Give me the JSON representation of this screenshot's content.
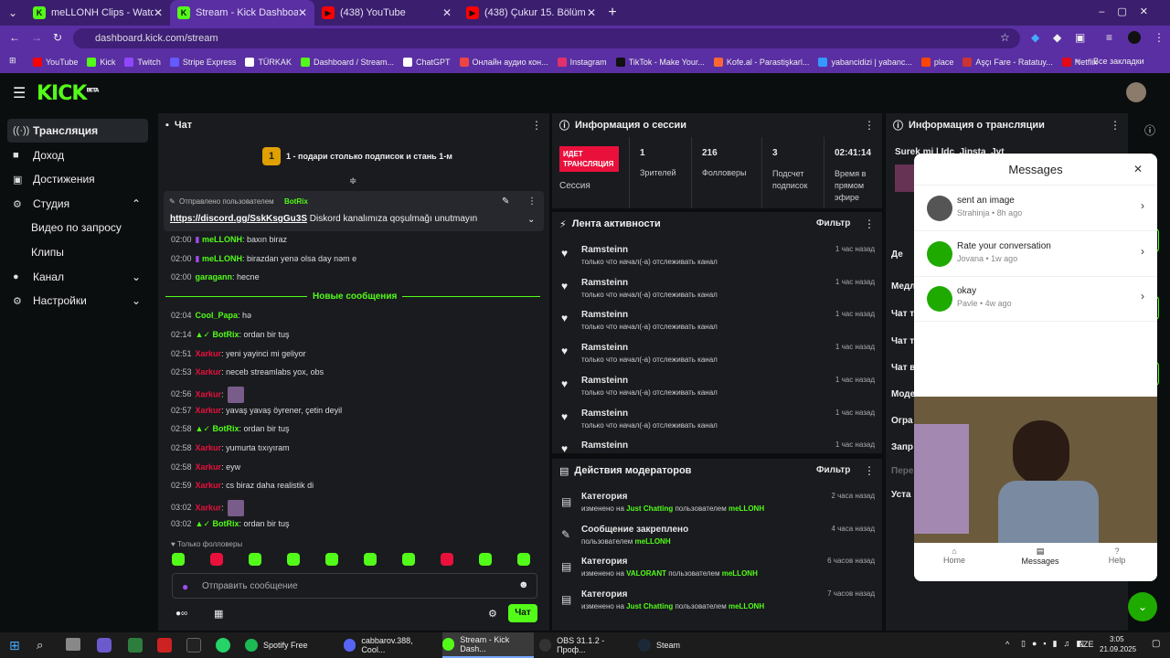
{
  "browser": {
    "tabs": [
      {
        "title": "meLLONH Clips - Watch Live or…",
        "fav": "K",
        "color": "#53fc18",
        "active": false
      },
      {
        "title": "Stream - Kick Dashboard",
        "fav": "K",
        "color": "#53fc18",
        "active": true
      },
      {
        "title": "(438) YouTube",
        "fav": "▶",
        "color": "#ff0000",
        "active": false
      },
      {
        "title": "(438) Çukur 15. Bölüm - YouTube",
        "fav": "▶",
        "color": "#ff0000",
        "active": false
      }
    ],
    "url": "dashboard.kick.com/stream",
    "bookmarks": [
      {
        "label": "YouTube",
        "color": "#ff0000"
      },
      {
        "label": "Kick",
        "color": "#53fc18"
      },
      {
        "label": "Twitch",
        "color": "#9146ff"
      },
      {
        "label": "Stripe Express",
        "color": "#635bff"
      },
      {
        "label": "TÜRKAK",
        "color": "#ffffff"
      },
      {
        "label": "Dashboard / Stream...",
        "color": "#53fc18"
      },
      {
        "label": "ChatGPT",
        "color": "#ffffff"
      },
      {
        "label": "Онлайн аудио кон...",
        "color": "#e44"
      },
      {
        "label": "Instagram",
        "color": "#e1306c"
      },
      {
        "label": "TikTok - Make Your...",
        "color": "#111111"
      },
      {
        "label": "Kofe.al - Parastişkarl...",
        "color": "#ff6633"
      },
      {
        "label": "yabancidizi | yabanc...",
        "color": "#3399ff"
      },
      {
        "label": "place",
        "color": "#ff4400"
      },
      {
        "label": "Aşçı Fare - Ratatuy...",
        "color": "#cc3333"
      },
      {
        "label": "Netflix",
        "color": "#e50914"
      }
    ],
    "all_bookmarks": "Все закладки"
  },
  "logo": "KICK",
  "logo_sup": "BETA",
  "sidebar": [
    {
      "label": "Трансляция",
      "icon": "broadcast-icon",
      "glyph": "((·))",
      "active": true
    },
    {
      "label": "Доход",
      "icon": "wallet-icon",
      "glyph": "■",
      "active": false
    },
    {
      "label": "Достижения",
      "icon": "trophy-icon",
      "glyph": "▣",
      "active": false
    },
    {
      "label": "Студия",
      "icon": "studio-icon",
      "glyph": "⚙",
      "active": false
    },
    {
      "label": "Видео по запросу",
      "icon": "",
      "glyph": "",
      "active": false
    },
    {
      "label": "Клипы",
      "icon": "",
      "glyph": "",
      "active": false
    },
    {
      "label": "Канал",
      "icon": "user-icon",
      "glyph": "●",
      "active": false
    },
    {
      "label": "Настройки",
      "icon": "gear-icon",
      "glyph": "⚙",
      "active": false
    }
  ],
  "chat": {
    "title": "Чат",
    "goal_num": "1",
    "goal_text": "1 - подари столько подписок и стань 1-м",
    "pinned_by": "Отправлено пользователем",
    "pinned_user": "BotRix",
    "pinned_link": "https://discord.gg/SskKsgGu3S",
    "pinned_text": " Diskord kanalımıza qoşulmağı unutmayın",
    "new_messages": "Новые сообщения",
    "followers_only": "Только фолловеры",
    "input_placeholder": "Отправить сообщение",
    "send": "Чат",
    "lines_before": [
      {
        "time": "02:00",
        "user": "meLLONH",
        "color": "grn",
        "text": ": baxın biraz"
      },
      {
        "time": "02:00",
        "user": "meLLONH",
        "color": "grn",
        "text": ": birazdan yenə olsa day nəm e"
      },
      {
        "time": "02:00",
        "user": "garagann",
        "color": "grn",
        "text": ": hecne"
      }
    ],
    "lines_after": [
      {
        "time": "02:04",
        "user": "Cool_Papa",
        "color": "grn",
        "text": ": hə"
      },
      {
        "time": "02:14",
        "user": "BotRix",
        "color": "grn",
        "text": ": ordan bir tuş"
      },
      {
        "time": "02:51",
        "user": "Xarkur",
        "color": "red",
        "text": ": yeni yayinci mi geliyor"
      },
      {
        "time": "02:53",
        "user": "Xarkur",
        "color": "red",
        "text": ": neceb streamlabs yox, obs"
      },
      {
        "time": "02:56",
        "user": "Xarkur",
        "color": "red",
        "text": ":"
      },
      {
        "time": "02:57",
        "user": "Xarkur",
        "color": "red",
        "text": ": yavaş yavaş öyrener, çetin deyil"
      },
      {
        "time": "02:58",
        "user": "BotRix",
        "color": "grn",
        "text": ": ordan bir tuş"
      },
      {
        "time": "02:58",
        "user": "Xarkur",
        "color": "red",
        "text": ": yumurta tıxıyıram"
      },
      {
        "time": "02:58",
        "user": "Xarkur",
        "color": "red",
        "text": ": eyw"
      },
      {
        "time": "02:59",
        "user": "Xarkur",
        "color": "red",
        "text": ": cs biraz daha realistik di"
      },
      {
        "time": "03:02",
        "user": "Xarkur",
        "color": "red",
        "text": ":"
      },
      {
        "time": "03:02",
        "user": "BotRix",
        "color": "grn",
        "text": ": ordan bir tuş"
      }
    ]
  },
  "session": {
    "title": "Информация о сессии",
    "live_badge": "ИДЕТ ТРАНСЛЯЦИЯ",
    "session_label": "Сессия",
    "viewers": "1",
    "viewers_label": "Зрителей",
    "followers": "216",
    "followers_label": "Фолловеры",
    "subs": "3",
    "subs_label": "Подсчет подписок",
    "uptime": "02:41:14",
    "uptime_label": "Время в прямом эфире"
  },
  "activity": {
    "title": "Лента активности",
    "filter": "Фильтр",
    "rows": [
      {
        "user": "Ramsteinn",
        "sub": "только что начал(-а) отслеживать канал",
        "time": "1 час назад"
      },
      {
        "user": "Ramsteinn",
        "sub": "только что начал(-а) отслеживать канал",
        "time": "1 час назад"
      },
      {
        "user": "Ramsteinn",
        "sub": "только что начал(-а) отслеживать канал",
        "time": "1 час назад"
      },
      {
        "user": "Ramsteinn",
        "sub": "только что начал(-а) отслеживать канал",
        "time": "1 час назад"
      },
      {
        "user": "Ramsteinn",
        "sub": "только что начал(-а) отслеживать канал",
        "time": "1 час назад"
      },
      {
        "user": "Ramsteinn",
        "sub": "только что начал(-а) отслеживать канал",
        "time": "1 час назад"
      },
      {
        "user": "Ramsteinn",
        "sub": "",
        "time": "1 час назад"
      }
    ]
  },
  "mod": {
    "title": "Действия модераторов",
    "filter": "Фильтр",
    "rows": [
      {
        "name": "Категория",
        "pre": "изменено на ",
        "cat": "Just Chatting",
        "mid": " пользователем ",
        "user": "meLLONH",
        "time": "2 часа назад",
        "icon": "category-icon",
        "glyph": "▤"
      },
      {
        "name": "Сообщение закреплено",
        "pre": "пользователем ",
        "cat": "",
        "mid": "",
        "user": "meLLONH",
        "time": "4 часа назад",
        "icon": "pin-icon",
        "glyph": "✎"
      },
      {
        "name": "Категория",
        "pre": "изменено на ",
        "cat": "VALORANT",
        "mid": " пользователем ",
        "user": "meLLONH",
        "time": "6 часов назад",
        "icon": "category-icon",
        "glyph": "▤"
      },
      {
        "name": "Категория",
        "pre": "изменено на ",
        "cat": "Just Chatting",
        "mid": " пользователем ",
        "user": "meLLONH",
        "time": "7 часов назад",
        "icon": "category-icon",
        "glyph": "▤"
      }
    ]
  },
  "stream_info": {
    "title": "Информация о трансляции",
    "stream_title": "Surek mi | Idc_Jinsta_Jyt",
    "labels": [
      "Де",
      "Медл",
      "Чат т",
      "Чат т",
      "Чат в",
      "Моде",
      "Огра",
      "Запр",
      "Пере",
      "Уста"
    ]
  },
  "messages": {
    "title": "Messages",
    "items": [
      {
        "text": "sent an image",
        "sub": "Strahinja • 8h ago",
        "avatar": "#555555"
      },
      {
        "text": "Rate your conversation",
        "sub": "Jovana • 1w ago",
        "avatar": "#1faa00"
      },
      {
        "text": "okay",
        "sub": "Pavle • 4w ago",
        "avatar": "#1faa00"
      }
    ],
    "nav": [
      "Home",
      "Messages",
      "Help"
    ]
  },
  "taskbar": {
    "items": [
      {
        "label": "Spotify Free",
        "color": "#1db954"
      },
      {
        "label": "cabbarov.388, Cool...",
        "color": "#5865f2"
      },
      {
        "label": "Stream - Kick Dash...",
        "color": "#53fc18"
      },
      {
        "label": "OBS 31.1.2 - Проф...",
        "color": "#333333"
      },
      {
        "label": "Steam",
        "color": "#1b2838"
      }
    ],
    "lang": "AZE",
    "time": "3:05",
    "date": "21.09.2025"
  }
}
